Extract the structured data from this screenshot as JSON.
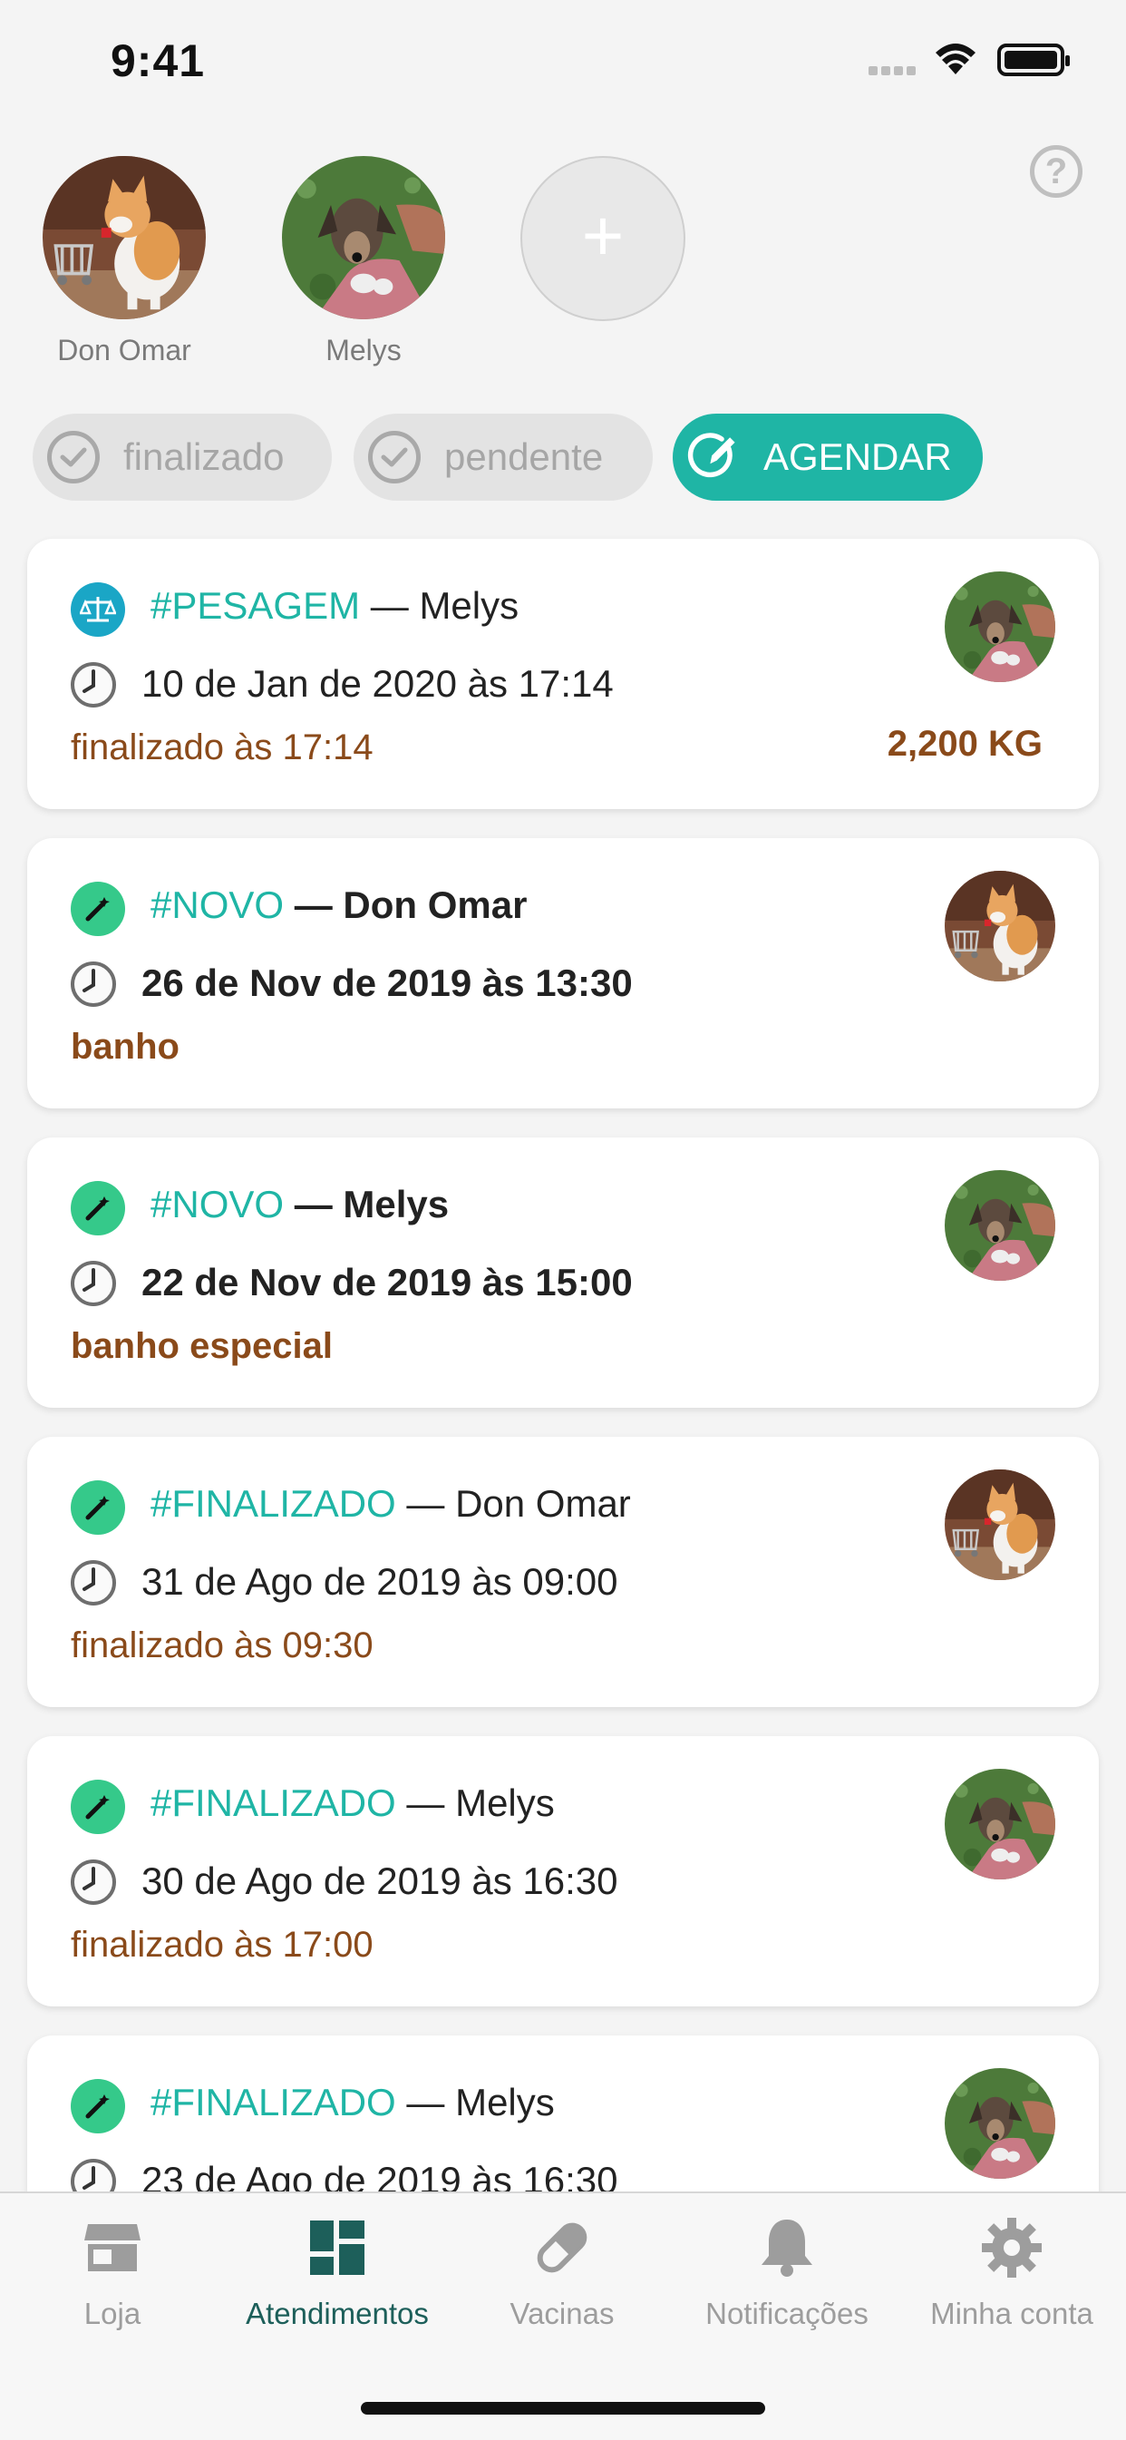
{
  "status_bar": {
    "time": "9:41"
  },
  "pets": [
    {
      "name": "Don Omar",
      "photo": "cat-photo"
    },
    {
      "name": "Melys",
      "photo": "dog-photo"
    }
  ],
  "add_pet_icon": "plus-icon",
  "help_icon": "question-icon",
  "filters": {
    "done": "finalizado",
    "pending": "pendente",
    "schedule": "AGENDAR"
  },
  "appointments": [
    {
      "tag": "#PESAGEM",
      "sep": " — ",
      "pet": "Melys",
      "date": "10 de Jan de 2020 às 17:14",
      "status": "finalizado às 17:14",
      "extra": "2,200 KG",
      "icon": "scale-icon",
      "icon_color": "#1aa6c6",
      "bold": false,
      "photo": "dog"
    },
    {
      "tag": "#NOVO",
      "sep": " — ",
      "pet": "Don Omar",
      "date": "26 de Nov de 2019 às 13:30",
      "status": "banho",
      "extra": "",
      "icon": "magic-wand-icon",
      "icon_color": "#35c98a",
      "bold": true,
      "photo": "cat"
    },
    {
      "tag": "#NOVO",
      "sep": " — ",
      "pet": "Melys",
      "date": "22 de Nov de 2019 às 15:00",
      "status": "banho especial",
      "extra": "",
      "icon": "magic-wand-icon",
      "icon_color": "#35c98a",
      "bold": true,
      "photo": "dog"
    },
    {
      "tag": "#FINALIZADO",
      "sep": " — ",
      "pet": "Don Omar",
      "date": "31 de Ago de 2019 às 09:00",
      "status": "finalizado às 09:30",
      "extra": "",
      "icon": "magic-wand-icon",
      "icon_color": "#35c98a",
      "bold": false,
      "photo": "cat"
    },
    {
      "tag": "#FINALIZADO",
      "sep": " — ",
      "pet": "Melys",
      "date": "30 de Ago de 2019 às 16:30",
      "status": "finalizado às 17:00",
      "extra": "",
      "icon": "magic-wand-icon",
      "icon_color": "#35c98a",
      "bold": false,
      "photo": "dog"
    },
    {
      "tag": "#FINALIZADO",
      "sep": " — ",
      "pet": "Melys",
      "date": "23 de Ago de 2019 às 16:30",
      "status": "",
      "extra": "",
      "icon": "magic-wand-icon",
      "icon_color": "#35c98a",
      "bold": false,
      "photo": "dog"
    }
  ],
  "tabs": [
    {
      "label": "Loja",
      "icon": "store-icon"
    },
    {
      "label": "Atendimentos",
      "icon": "dashboard-icon",
      "active": true
    },
    {
      "label": "Vacinas",
      "icon": "pill-icon"
    },
    {
      "label": "Notificações",
      "icon": "bell-icon"
    },
    {
      "label": "Minha conta",
      "icon": "gear-icon"
    }
  ],
  "colors": {
    "accent": "#1fb5a5",
    "brown": "#8a4a1a",
    "active_tab": "#1d5f5a"
  }
}
